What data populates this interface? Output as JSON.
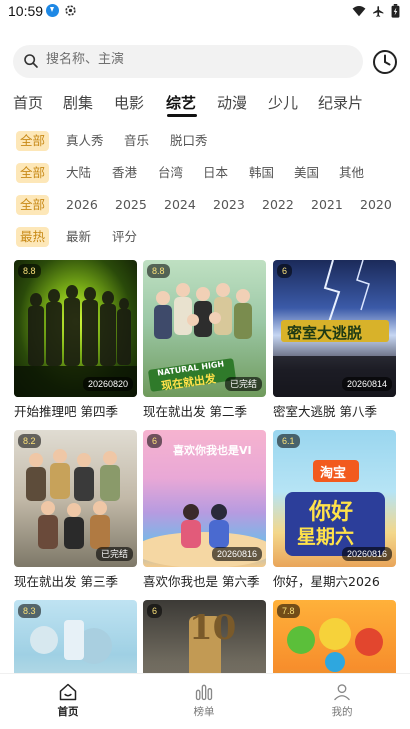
{
  "status": {
    "time": "10:59",
    "icons": [
      "download-icon",
      "settings-icon",
      "wifi-icon",
      "airplane-icon",
      "battery-icon"
    ]
  },
  "search": {
    "placeholder": "搜名称、主演"
  },
  "categories": {
    "tabs": [
      "首页",
      "剧集",
      "电影",
      "综艺",
      "动漫",
      "少儿",
      "纪录片"
    ],
    "active": "综艺"
  },
  "filters": {
    "type": [
      "全部",
      "真人秀",
      "音乐",
      "脱口秀"
    ],
    "region": [
      "全部",
      "大陆",
      "香港",
      "台湾",
      "日本",
      "韩国",
      "美国",
      "其他"
    ],
    "year": [
      "全部",
      "2026",
      "2025",
      "2024",
      "2023",
      "2022",
      "2021",
      "2020"
    ],
    "sort": [
      "最热",
      "最新",
      "评分"
    ]
  },
  "shows": [
    {
      "title": "开始推理吧 第四季",
      "rating": "8.8",
      "badge": "20260820"
    },
    {
      "title": "现在就出发 第二季",
      "rating": "8.8",
      "badge": "已完结"
    },
    {
      "title": "密室大逃脱 第八季",
      "rating": "6",
      "badge": "20260814"
    },
    {
      "title": "现在就出发 第三季",
      "rating": "8.2",
      "badge": "已完结"
    },
    {
      "title": "喜欢你我也是 第六季",
      "rating": "6",
      "badge": "20260816"
    },
    {
      "title": "你好，星期六2026",
      "rating": "6.1",
      "badge": "20260816"
    },
    {
      "title": "",
      "rating": "8.3",
      "badge": ""
    },
    {
      "title": "",
      "rating": "6",
      "badge": ""
    },
    {
      "title": "",
      "rating": "7.8",
      "badge": ""
    }
  ],
  "poster_texts": {
    "natural_high": "NATURAL HIGH",
    "xianzai": "现在就出发",
    "mishi": "密室大逃脱",
    "xihuan": "喜欢你我也是VI",
    "taobao": "淘宝",
    "nihao": "你好",
    "xingqiliu": "星期六",
    "ten": "10"
  },
  "nav": {
    "home": "首页",
    "ranking": "榜单",
    "mine": "我的"
  },
  "colors": {
    "accent": "#c88a18",
    "chip_bg": "#fde7b8"
  }
}
